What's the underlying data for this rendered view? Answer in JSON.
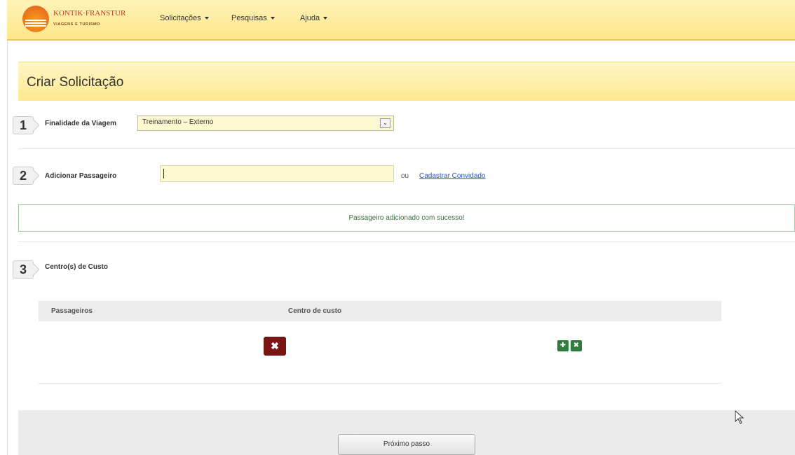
{
  "brand": {
    "name": "KONTIK·FRANSTUR",
    "tagline": "VIAGENS E TURISMO",
    "accent_color": "#fde68a"
  },
  "nav": {
    "menus": [
      {
        "label": "Solicitações"
      },
      {
        "label": "Pesquisas"
      },
      {
        "label": "Ajuda"
      }
    ]
  },
  "page": {
    "title": "Criar Solicitação"
  },
  "step1": {
    "number": "1",
    "label": "Finalidade da Viagem",
    "selected": "Treinamento – Externo"
  },
  "step2": {
    "number": "2",
    "label": "Adicionar Passageiro",
    "input_value": "",
    "or_text": "ou",
    "link_label": "Cadastrar Convidado",
    "success_message": "Passageiro adicionado com sucesso!"
  },
  "step3": {
    "number": "3",
    "label": "Centro(s) de Custo",
    "columns": [
      "Passageiros",
      "Centro de custo"
    ]
  },
  "footer": {
    "next_label": "Próximo passo"
  },
  "icons": {
    "remove": "close-icon",
    "add": "add-icon",
    "remove_small": "close-icon"
  }
}
